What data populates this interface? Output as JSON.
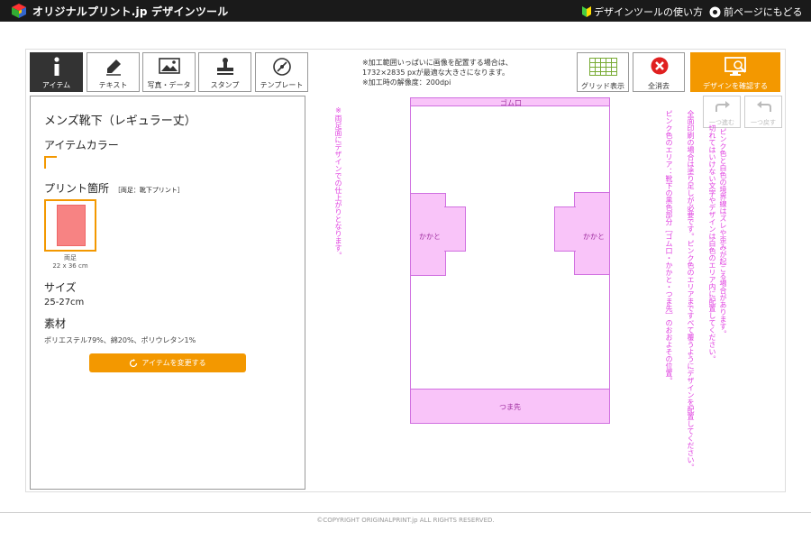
{
  "header": {
    "logo_text": "オリジナルプリント.jp デザインツール",
    "guide_link": "デザインツールの使い方",
    "back_link": "前ページにもどる"
  },
  "tabs": [
    {
      "label": "アイテム",
      "icon": "info-icon",
      "active": true
    },
    {
      "label": "テキスト",
      "icon": "pen-icon",
      "active": false
    },
    {
      "label": "写真・データ",
      "icon": "image-icon",
      "active": false
    },
    {
      "label": "スタンプ",
      "icon": "stamp-icon",
      "active": false
    },
    {
      "label": "テンプレート",
      "icon": "template-icon",
      "active": false
    }
  ],
  "item_panel": {
    "title": "メンズ靴下（レギュラー丈）",
    "color_heading": "アイテムカラー",
    "print_heading": "プリント箇所",
    "print_note": "［両足：靴下プリント］",
    "thumb_label": "両足",
    "thumb_size": "22 x 36 cm",
    "size_heading": "サイズ",
    "size_value": "25-27cm",
    "material_heading": "素材",
    "material_value": "ポリエステル79%、綿20%、ポリウレタン1%",
    "change_button": "アイテムを変更する"
  },
  "print_note_lines": [
    "※加工範囲いっぱいに画像を配置する場合は、",
    "1732×2835 pxが最適な大きさになります。",
    "※加工時の解像度：200dpi"
  ],
  "toolbar": {
    "grid_label": "グリッド表示",
    "clear_label": "全消去",
    "confirm_label": "デザインを確認する",
    "redo_label": "一つ進む",
    "undo_label": "一つ戻す"
  },
  "canvas": {
    "left_note": "※両足面にデザインでの仕上がりとなります。",
    "right_note_1": "ピンク色と白色の境界線はズレや歪みが起こる場合があります。",
    "right_note_2": "切れてはいけない文字やデザインは白色のエリア内に配置してください。",
    "right_note_3": "全面印刷の場合は塗り足しが必要です。ピンク色のエリアまですべて覆うようにデザインを配置してください。",
    "right_note_4": "ピンク色のエリア：靴下の黒色部分［ゴム口・かかと・つま先］のおおよその位置。",
    "top_band": "ゴム口",
    "heel_left": "かかと",
    "heel_right": "かかと",
    "toe": "つま先"
  },
  "footer": "©COPYRIGHT ORIGINALPRINT.jp ALL RIGHTS RESERVED.",
  "colors": {
    "accent": "#f39800",
    "pink_area": "#f9c4f9",
    "note_pink": "#e040e0",
    "thumb_fill": "#f78383"
  }
}
